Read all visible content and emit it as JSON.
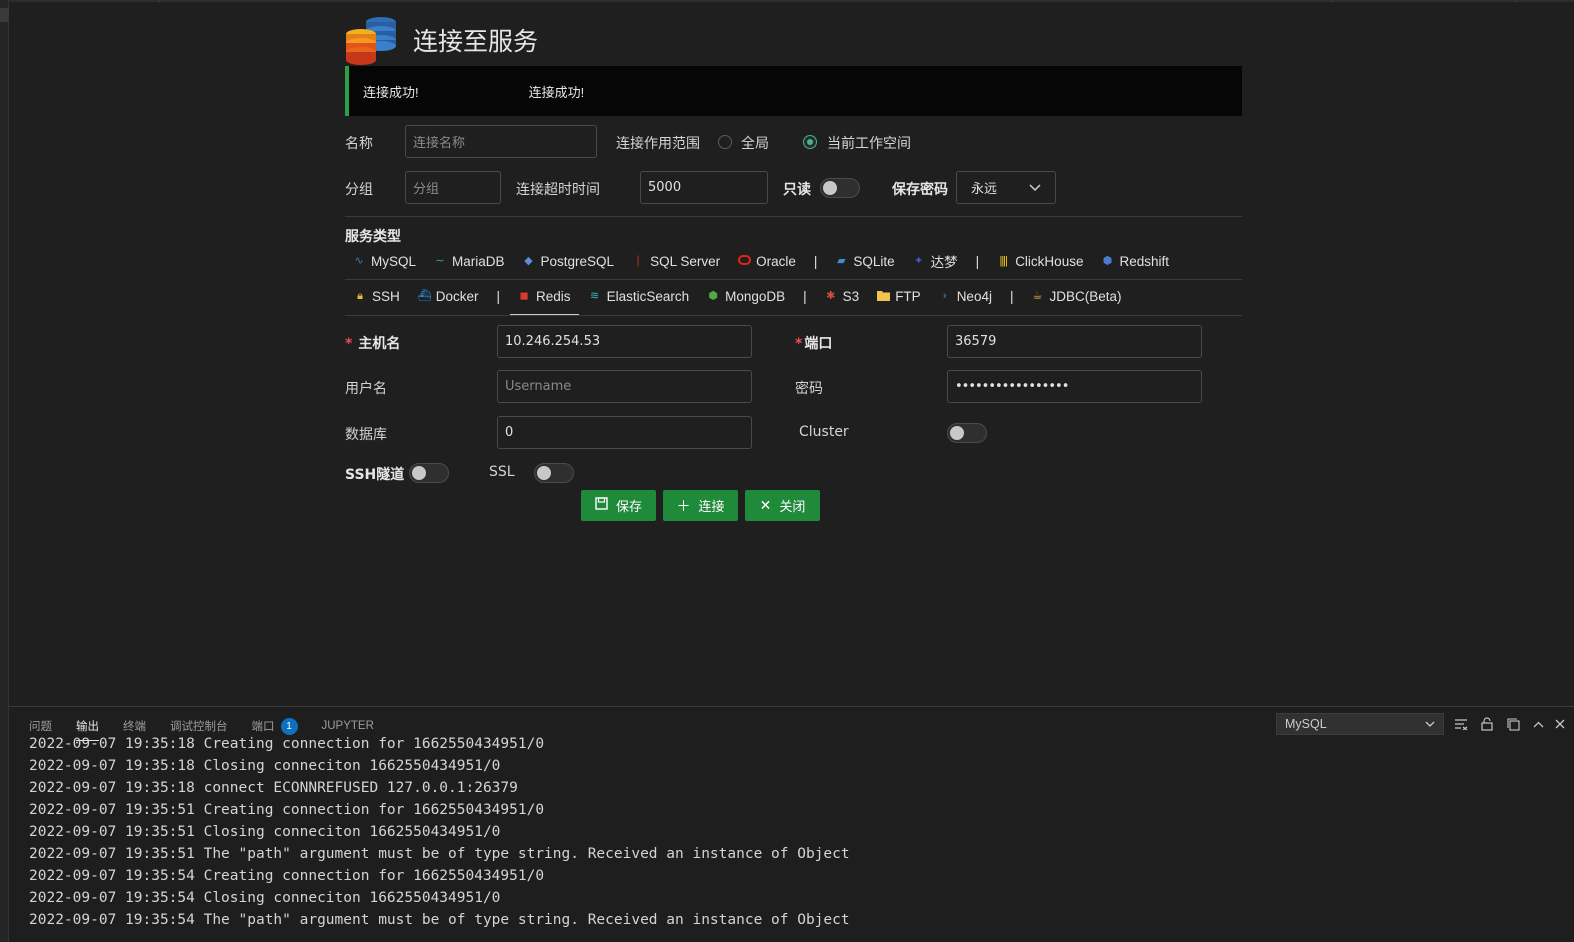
{
  "header": {
    "title": "连接至服务"
  },
  "alert": {
    "messages": [
      "连接成功!",
      "连接成功!"
    ]
  },
  "form": {
    "name_label": "名称",
    "name_placeholder": "连接名称",
    "scope_label": "连接作用范围",
    "scope_options": [
      "全局",
      "当前工作空间"
    ],
    "scope_selected": "当前工作空间",
    "group_label": "分组",
    "group_placeholder": "分组",
    "timeout_label": "连接超时时间",
    "timeout_value": "5000",
    "readonly_label": "只读",
    "readonly_on": false,
    "save_password_label": "保存密码",
    "save_password_value": "永远"
  },
  "service_type": {
    "label": "服务类型",
    "row1": [
      "MySQL",
      "MariaDB",
      "PostgreSQL",
      "SQL Server",
      "Oracle",
      "|",
      "SQLite",
      "达梦",
      "|",
      "ClickHouse",
      "Redshift"
    ],
    "row2": [
      "SSH",
      "Docker",
      "|",
      "Redis",
      "ElasticSearch",
      "MongoDB",
      "|",
      "S3",
      "FTP",
      "Neo4j",
      "|",
      "JDBC(Beta)"
    ],
    "selected": "Redis"
  },
  "redis": {
    "host_label": "主机名",
    "host_value": "10.246.254.53",
    "port_label": "端口",
    "port_value": "36579",
    "username_label": "用户名",
    "username_placeholder": "Username",
    "password_label": "密码",
    "password_value": "•••••••••••••••••",
    "database_label": "数据库",
    "database_value": "0",
    "cluster_label": "Cluster",
    "cluster_on": false,
    "ssh_tunnel_label": "SSH隧道",
    "ssh_tunnel_on": false,
    "ssl_label": "SSL",
    "ssl_on": false
  },
  "buttons": {
    "save": "保存",
    "connect": "连接",
    "close": "关闭"
  },
  "panel": {
    "tabs": [
      "问题",
      "输出",
      "终端",
      "调试控制台",
      "端口",
      "JUPYTER"
    ],
    "active_tab": "输出",
    "ports_badge": "1",
    "output_channel": "MySQL",
    "log_lines": [
      "2022-09-07 19:35:18 Creating connection for 1662550434951/0",
      "2022-09-07 19:35:18 Closing conneciton 1662550434951/0",
      "2022-09-07 19:35:18 connect ECONNREFUSED 127.0.0.1:26379",
      "2022-09-07 19:35:51 Creating connection for 1662550434951/0",
      "2022-09-07 19:35:51 Closing conneciton 1662550434951/0",
      "2022-09-07 19:35:51 The \"path\" argument must be of type string. Received an instance of Object",
      "2022-09-07 19:35:54 Creating connection for 1662550434951/0",
      "2022-09-07 19:35:54 Closing conneciton 1662550434951/0",
      "2022-09-07 19:35:54 The \"path\" argument must be of type string. Received an instance of Object"
    ]
  },
  "colors": {
    "accent_green": "#1f8a3a",
    "success_bar": "#2ea043",
    "radio_selected": "#44b58a",
    "badge_blue": "#0e70c0"
  }
}
